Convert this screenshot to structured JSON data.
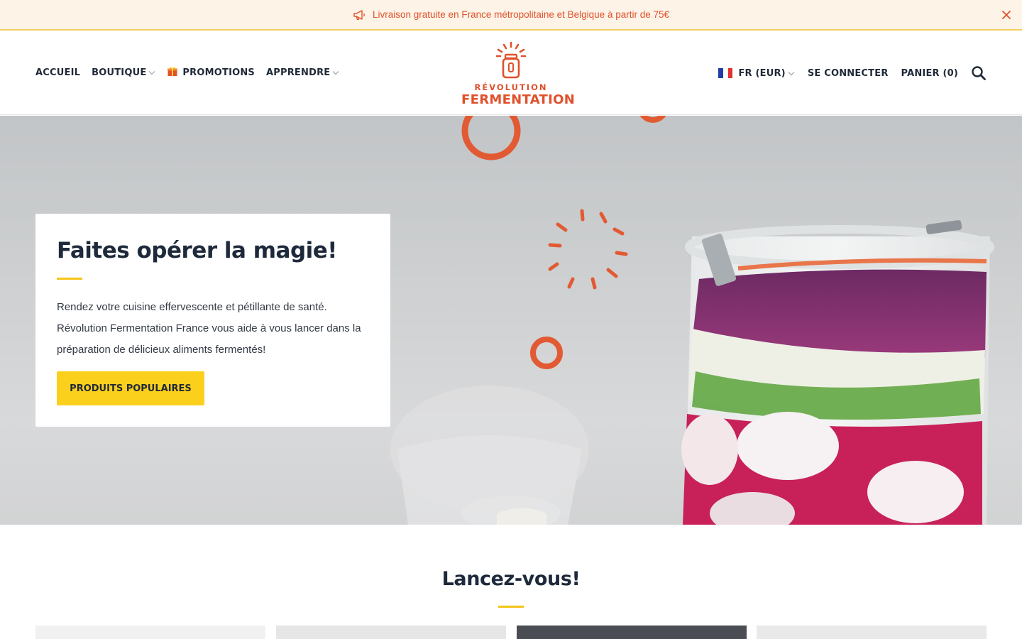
{
  "announcement": {
    "text": "Livraison gratuite en France métropolitaine et Belgique à partir de 75€",
    "icon": "megaphone-icon",
    "close_icon": "close-icon"
  },
  "nav": {
    "left": [
      {
        "label": "ACCUEIL",
        "dropdown": false
      },
      {
        "label": "BOUTIQUE",
        "dropdown": true
      },
      {
        "label": "PROMOTIONS",
        "dropdown": false,
        "icon": "gift-icon"
      },
      {
        "label": "APPRENDRE",
        "dropdown": true
      }
    ],
    "right": {
      "language": "FR (EUR)",
      "login": "SE CONNECTER",
      "cart": "PANIER (0)",
      "search_icon": "search-icon"
    }
  },
  "logo": {
    "line1": "RÉVOLUTION",
    "line2": "FERMENTATION"
  },
  "hero": {
    "title": "Faites opérer la magie!",
    "text": "Rendez votre cuisine effervescente et pétillante de santé. Révolution Fermentation France vous aide à vous lancer dans la préparation de délicieux aliments fermentés!",
    "button": "PRODUITS POPULAIRES"
  },
  "section": {
    "title": "Lancez-vous!"
  },
  "colors": {
    "accent_orange": "#e0512c",
    "accent_yellow": "#fbd01c",
    "announcement_bg": "#fdf3e7",
    "heading": "#1e2a3b"
  }
}
